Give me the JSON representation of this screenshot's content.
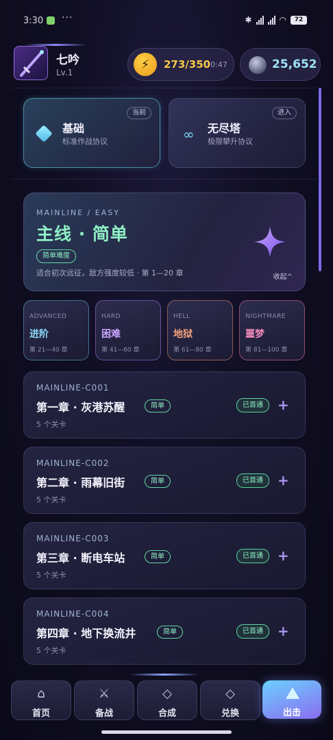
{
  "status_bar": {
    "time": "3:30",
    "more": "···",
    "battery": "72"
  },
  "user": {
    "name": "七吟",
    "level": "Lv.1"
  },
  "energy": {
    "value": "273/350",
    "timer": "0:47"
  },
  "gems": {
    "value": "25,652"
  },
  "modes": [
    {
      "title": "基础",
      "subtitle": "标准作战协议",
      "badge": "当前"
    },
    {
      "title": "无尽塔",
      "subtitle": "极限攀升协议",
      "badge": "进入"
    }
  ],
  "hero": {
    "kicker": "MAINLINE / EASY",
    "title": "主线 · 简单",
    "tag": "简单难度",
    "description": "适合初次远征，敌方强度较低 · 第 1—20 章",
    "collapse": "收起^"
  },
  "difficulties": [
    {
      "en": "ADVANCED",
      "cn": "进阶",
      "range": "第 21—40 章"
    },
    {
      "en": "HARD",
      "cn": "困难",
      "range": "第 41—60 章"
    },
    {
      "en": "HELL",
      "cn": "地狱",
      "range": "第 61—80 章"
    },
    {
      "en": "NIGHTMARE",
      "cn": "噩梦",
      "range": "第 81—100 章"
    }
  ],
  "chapters": [
    {
      "code": "MAINLINE-C001",
      "title": "第一章 · 灰港苏醒",
      "tag": "简单",
      "stages": "5 个关卡",
      "status": "已首通"
    },
    {
      "code": "MAINLINE-C002",
      "title": "第二章 · 雨幕旧街",
      "tag": "简单",
      "stages": "5 个关卡",
      "status": "已首通"
    },
    {
      "code": "MAINLINE-C003",
      "title": "第三章 · 断电车站",
      "tag": "简单",
      "stages": "5 个关卡",
      "status": "已首通"
    },
    {
      "code": "MAINLINE-C004",
      "title": "第四章 · 地下换流井",
      "tag": "简单",
      "stages": "5 个关卡",
      "status": "已首通"
    }
  ],
  "nav": [
    {
      "label": "首页",
      "icon": "home-icon"
    },
    {
      "label": "备战",
      "icon": "crossed-swords-icon"
    },
    {
      "label": "合成",
      "icon": "diamond-icon"
    },
    {
      "label": "兑换",
      "icon": "diamond-icon"
    },
    {
      "label": "出击",
      "icon": "triangle-icon"
    }
  ],
  "colors": {
    "accent_green": "#8ff0c4",
    "accent_gold": "#f6c84a",
    "accent_cyan": "#9fe3f8",
    "accent_purple": "#8a6cf0"
  }
}
